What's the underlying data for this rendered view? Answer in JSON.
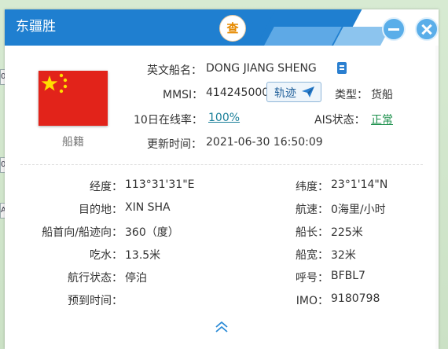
{
  "window": {
    "title": "东疆胜",
    "query_label": "查"
  },
  "map_edge_labels": [
    "0",
    "0",
    "A"
  ],
  "ship": {
    "flag_caption": "船籍",
    "name_label": "英文船名：",
    "name_value": "DONG JIANG SHENG",
    "mmsi_label": "MMSI：",
    "mmsi_value": "414245000",
    "track_button": "轨迹",
    "type_label": "类型：",
    "type_value": "货船",
    "online_label": "10日在线率：",
    "online_value": "100%",
    "ais_label": "AIS状态：",
    "ais_value": "正常",
    "updated_label": "更新时间：",
    "updated_value": "2021-06-30 16:50:09"
  },
  "details_left": [
    {
      "label": "经度：",
      "value": "113°31'31\"E"
    },
    {
      "label": "目的地：",
      "value": "XIN SHA"
    },
    {
      "label": "船首向/船迹向：",
      "value": "360（度）"
    },
    {
      "label": "吃水：",
      "value": "13.5米"
    },
    {
      "label": "航行状态：",
      "value": "停泊"
    },
    {
      "label": "预到时间：",
      "value": ""
    }
  ],
  "details_right": [
    {
      "label": "纬度：",
      "value": "23°1'14\"N"
    },
    {
      "label": "航速：",
      "value": "0海里/小时"
    },
    {
      "label": "船长：",
      "value": "225米"
    },
    {
      "label": "船宽：",
      "value": "32米"
    },
    {
      "label": "呼号：",
      "value": "BFBL7"
    },
    {
      "label": "IMO：",
      "value": "9180798"
    }
  ],
  "colors": {
    "title_bar": "#1f7fd0",
    "query_accent": "#e68a00",
    "link": "#1a7f99",
    "status_ok": "#1a8f4a",
    "flag_red": "#e2231a",
    "flag_star": "#ffde00"
  },
  "icons": {
    "query": "query-badge",
    "minimize": "minimize-icon",
    "close": "close-icon",
    "book": "book-icon",
    "track": "paper-plane-icon",
    "expand": "chevron-double-up-icon"
  }
}
